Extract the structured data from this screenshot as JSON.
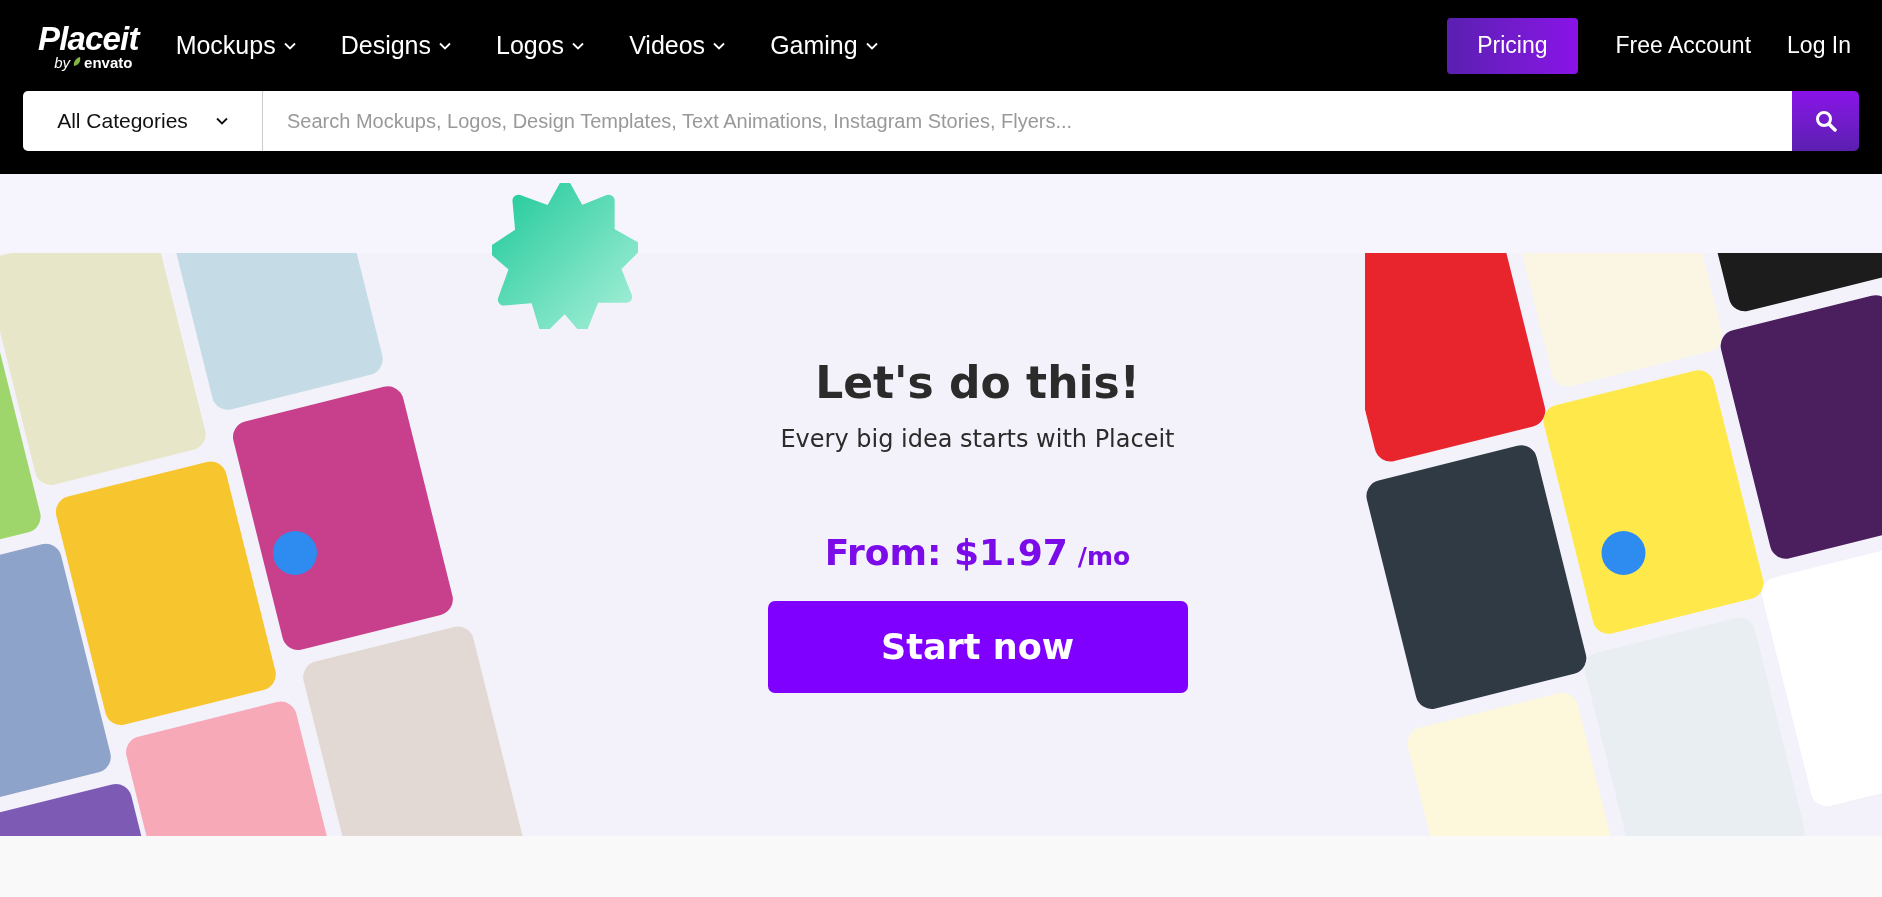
{
  "header": {
    "logo": {
      "name": "Placeit",
      "byline": "by",
      "brand": "envato"
    },
    "nav": [
      {
        "label": "Mockups"
      },
      {
        "label": "Designs"
      },
      {
        "label": "Logos"
      },
      {
        "label": "Videos"
      },
      {
        "label": "Gaming"
      }
    ],
    "pricing": "Pricing",
    "free_account": "Free Account",
    "log_in": "Log In"
  },
  "search": {
    "category": "All Categories",
    "placeholder": "Search Mockups, Logos, Design Templates, Text Animations, Instagram Stories, Flyers..."
  },
  "hero": {
    "title": "Let's do this!",
    "subtitle": "Every big idea starts with Placeit",
    "price": "From: $1.97",
    "period": "/mo",
    "cta": "Start now"
  }
}
